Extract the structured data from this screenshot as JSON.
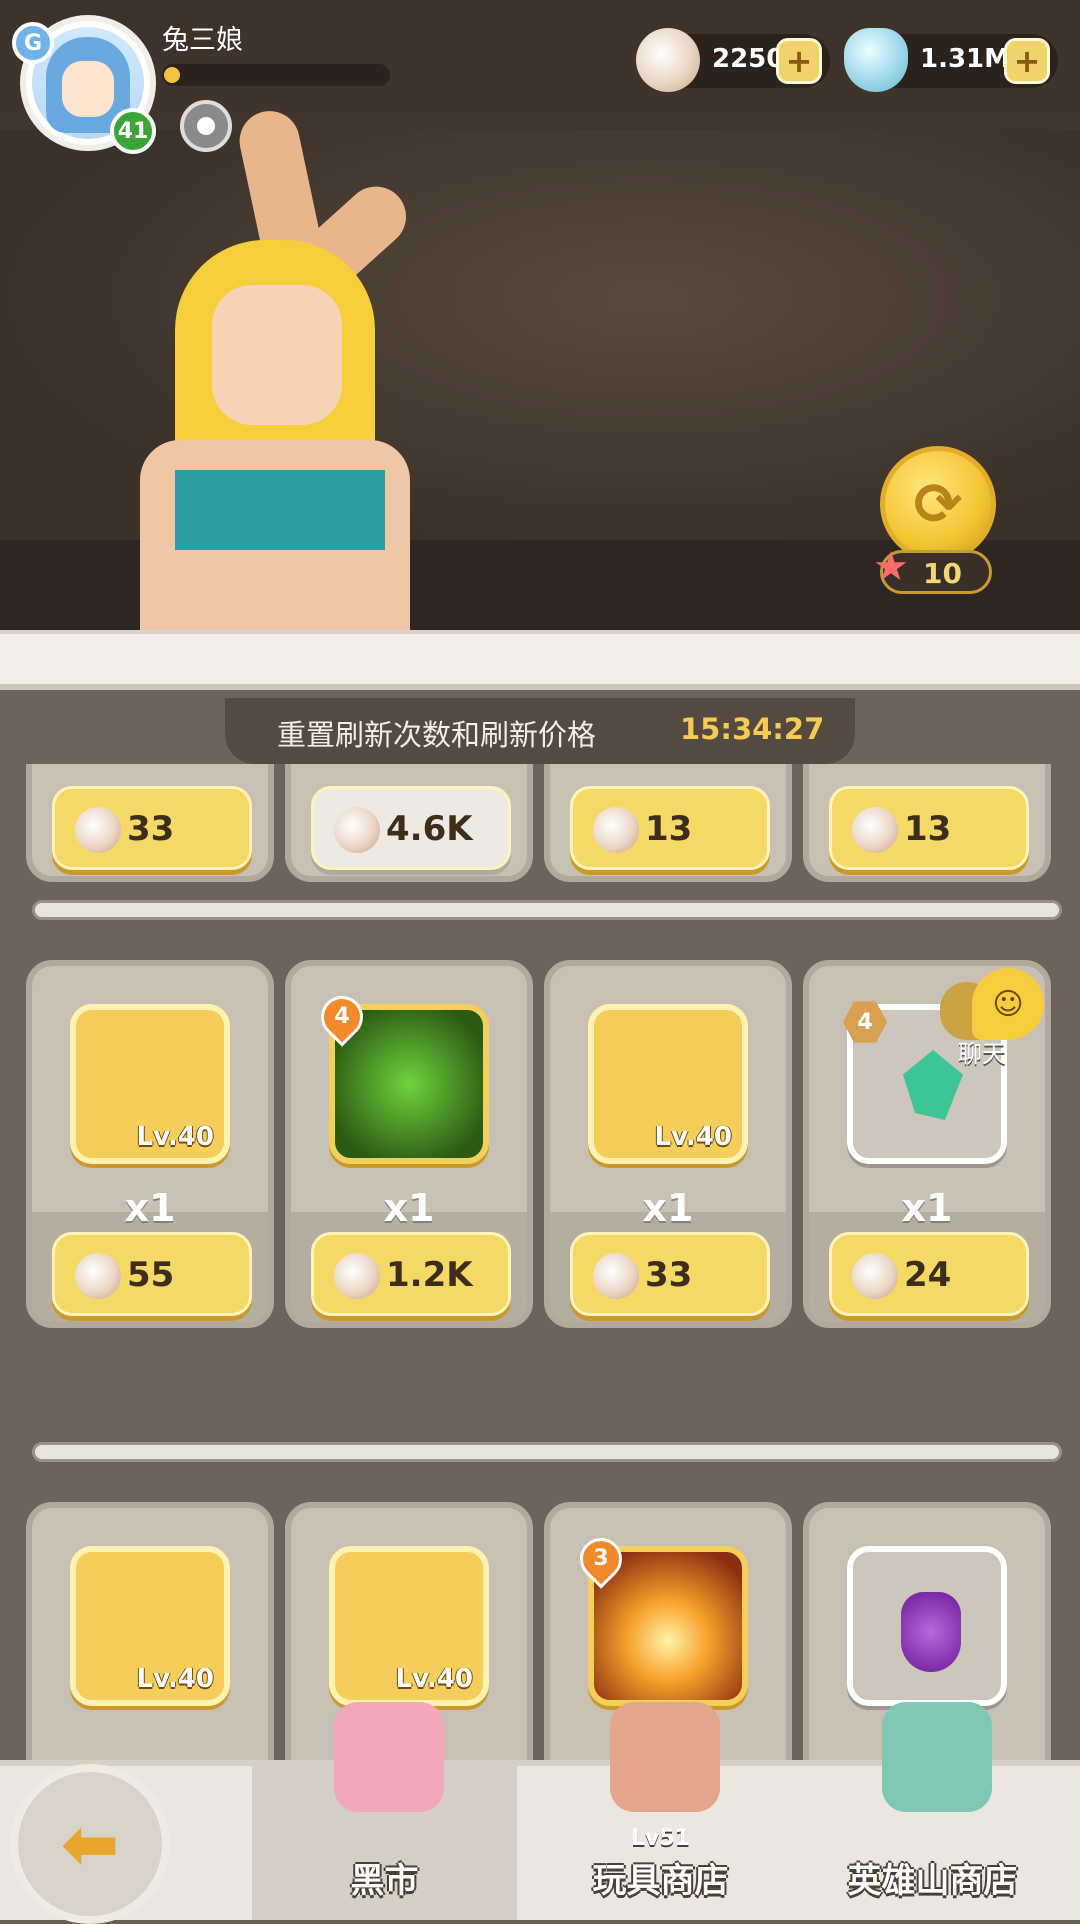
{
  "player": {
    "name": "兔三娘",
    "level": "41",
    "xp_fraction": 0.06,
    "badge": "G"
  },
  "currencies": {
    "shells": {
      "value": "2250",
      "plus": "+"
    },
    "pearls": {
      "value": "1.31M",
      "plus": "+"
    }
  },
  "refresh": {
    "cost": "10"
  },
  "timer": {
    "label": "重置刷新次数和刷新价格",
    "value": "15:34:27"
  },
  "row_top_partial": {
    "prices": [
      "33",
      "4.6K",
      "13",
      "13"
    ]
  },
  "row1": [
    {
      "level": "Lv.40",
      "qty": "x1",
      "price": "55",
      "icon": "horn-icon"
    },
    {
      "badge": "4",
      "qty": "x1",
      "price": "1.2K",
      "icon": "robot-skill-icon"
    },
    {
      "level": "Lv.40",
      "qty": "x1",
      "price": "33",
      "icon": "crystal-shards-icon"
    },
    {
      "badge": "4",
      "qty": "x1",
      "price": "24",
      "icon": "green-gem-icon"
    }
  ],
  "row2": [
    {
      "level": "Lv.40",
      "icon": "bandage-feather-icon"
    },
    {
      "level": "Lv.40",
      "icon": "leaf-blade-icon"
    },
    {
      "badge": "3",
      "icon": "sun-flame-icon"
    },
    {
      "icon": "grapes-icon"
    }
  ],
  "chat": {
    "label": "聊天"
  },
  "nav": {
    "back_icon": "back-arrow-icon",
    "tabs": [
      {
        "label": "黑市",
        "active": true
      },
      {
        "label": "玩具商店",
        "lock": "Lv51"
      },
      {
        "label": "英雄山商店"
      }
    ]
  },
  "colors": {
    "gold": "#f6d867",
    "timer": "#f5cb55",
    "panel": "#6e6358"
  }
}
